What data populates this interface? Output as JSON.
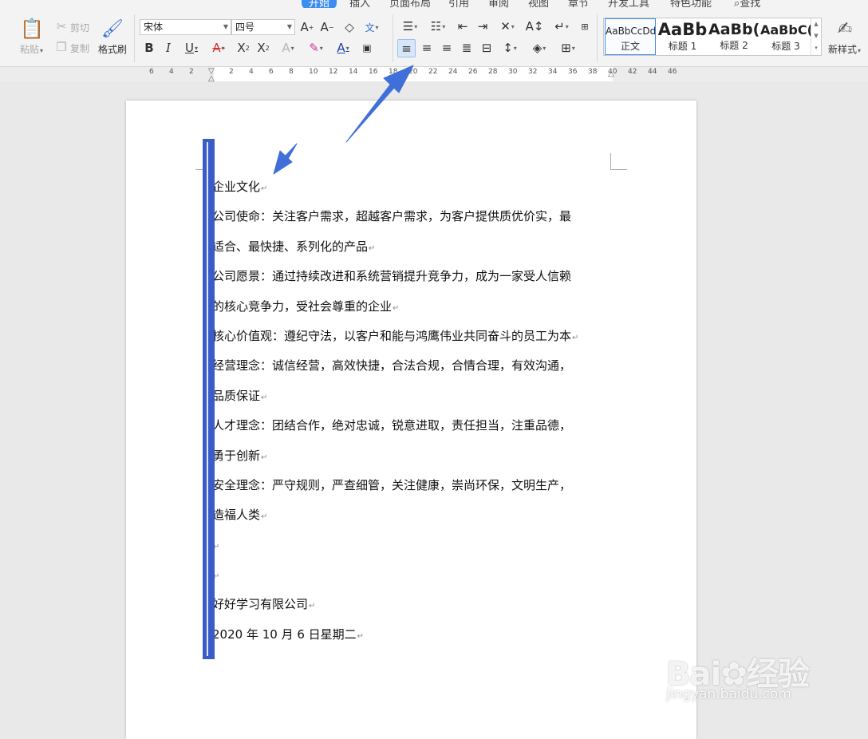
{
  "tabs": [
    "开始",
    "插入",
    "页面布局",
    "引用",
    "审阅",
    "视图",
    "章节",
    "开发工具",
    "特色功能",
    "查找"
  ],
  "clipboard": {
    "paste": "粘贴",
    "cut": "剪切",
    "copy": "复制",
    "format_painter": "格式刷"
  },
  "font": {
    "name": "宋体",
    "size": "四号"
  },
  "styles": [
    {
      "sample": "AaBbCcDd",
      "name": "正文"
    },
    {
      "sample": "AaBb",
      "name": "标题 1"
    },
    {
      "sample": "AaBb(",
      "name": "标题 2"
    },
    {
      "sample": "AaBbC(",
      "name": "标题 3"
    }
  ],
  "new_style": "新样式",
  "ruler_numbers": [
    "6",
    "4",
    "2",
    "2",
    "4",
    "6",
    "8",
    "10",
    "12",
    "14",
    "16",
    "18",
    "20",
    "22",
    "24",
    "26",
    "28",
    "30",
    "32",
    "34",
    "36",
    "38",
    "40",
    "42",
    "44",
    "46"
  ],
  "document": {
    "paragraphs": [
      "企业文化",
      "公司使命：关注客户需求，超越客户需求，为客户提供质优价实，最",
      "适合、最快捷、系列化的产品",
      "公司愿景：通过持续改进和系统营销提升竞争力，成为一家受人信赖",
      "的核心竞争力，受社会尊重的企业",
      "核心价值观：遵纪守法，以客户和能与鸿鹰伟业共同奋斗的员工为本",
      "经营理念：诚信经营，高效快捷，合法合规，合情合理，有效沟通，",
      "品质保证",
      "人才理念：团结合作，绝对忠诚，锐意进取，责任担当，注重品德，",
      "勇于创新",
      "安全理念：严守规则，严查细管，关注健康，崇尚环保，文明生产，",
      "造福人类",
      "",
      "",
      "好好学习有限公司",
      "2020 年 10 月 6 日星期二"
    ],
    "paragraph_mark": "↵"
  },
  "watermark": {
    "logo": "Bai",
    "logo_suffix": "经验",
    "url": "jingyan.baidu.com"
  },
  "colors": {
    "accent": "#3f8cf0",
    "selection": "#3b5bc8",
    "arrow": "#3f6fd8"
  }
}
